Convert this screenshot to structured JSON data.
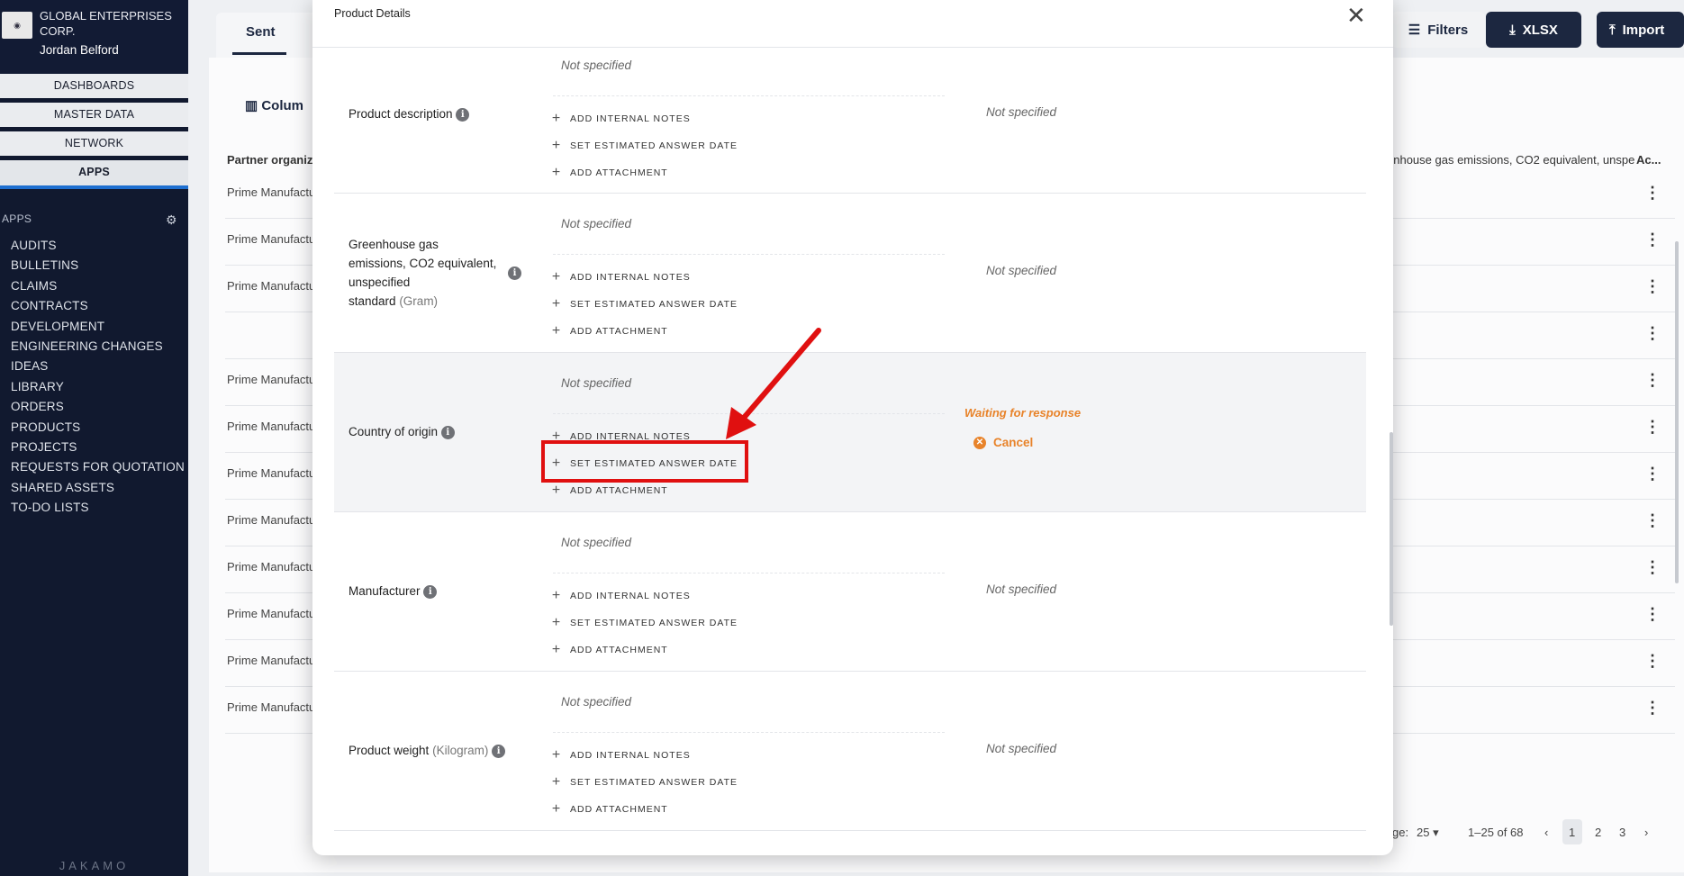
{
  "sidebar": {
    "org_name": "GLOBAL ENTERPRISES CORP.",
    "user_name": "Jordan Belford",
    "nav": [
      "DASHBOARDS",
      "MASTER DATA",
      "NETWORK",
      "APPS"
    ],
    "apps_heading": "APPS",
    "apps": [
      "AUDITS",
      "BULLETINS",
      "CLAIMS",
      "CONTRACTS",
      "DEVELOPMENT",
      "ENGINEERING CHANGES",
      "IDEAS",
      "LIBRARY",
      "ORDERS",
      "PRODUCTS",
      "PROJECTS",
      "REQUESTS FOR QUOTATION",
      "SHARED ASSETS",
      "TO-DO LISTS"
    ],
    "brand": "JAKAMO"
  },
  "background": {
    "tab": "Sent",
    "columns_label": "Colum",
    "header_partner": "Partner organiza",
    "header_ghg": "enhouse gas emissions, CO2 equivalent, unspe",
    "header_actions": "Ac...",
    "rows": [
      "Prime Manufactu",
      "Prime Manufactu",
      "Prime Manufactu",
      "",
      "Prime Manufactu",
      "Prime Manufactu",
      "Prime Manufactu",
      "Prime Manufactu",
      "Prime Manufactu",
      "Prime Manufactu",
      "Prime Manufactu",
      "Prime Manufactu"
    ],
    "filters_label": "Filters",
    "xlsx_label": "XLSX",
    "import_label": "Import",
    "pager_label": "ge:",
    "pager_size": "25",
    "pager_range": "1–25 of 68",
    "pages": [
      "1",
      "2",
      "3"
    ]
  },
  "modal": {
    "title": "Product Details",
    "not_specified": "Not specified",
    "actions": {
      "internal_notes": "ADD INTERNAL NOTES",
      "estimated_date": "SET ESTIMATED ANSWER DATE",
      "attachment": "ADD ATTACHMENT"
    },
    "sections": [
      {
        "label": "Product description",
        "unit": ""
      },
      {
        "label_lines": [
          "Greenhouse gas",
          "emissions, CO2 equivalent,",
          "unspecified",
          "standard"
        ],
        "unit": "(Gram)"
      },
      {
        "label": "Country of origin",
        "unit": "",
        "status": "Waiting for response",
        "cancel": "Cancel"
      },
      {
        "label": "Manufacturer",
        "unit": ""
      },
      {
        "label": "Product weight",
        "unit": "(Kilogram)"
      }
    ]
  },
  "colors": {
    "accent_orange": "#e8832a",
    "annotation_red": "#e01010",
    "sidebar_bg": "#11192f",
    "button_navy": "#1c2740"
  }
}
